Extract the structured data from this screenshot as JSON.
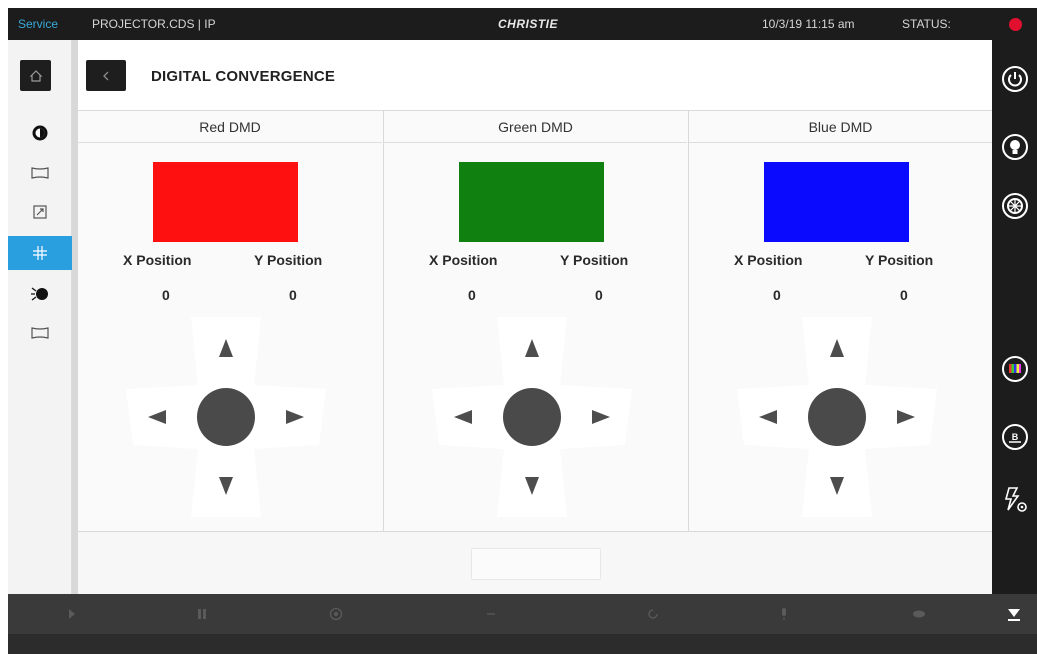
{
  "topbar": {
    "mode": "Service",
    "breadcrumb": "PROJECTOR.CDS | IP",
    "brand": "CHRISTIE",
    "datetime": "10/3/19  11:15 am",
    "status_label": "STATUS:",
    "status_color": "#e0102e"
  },
  "page": {
    "title": "DIGITAL CONVERGENCE"
  },
  "panels": [
    {
      "heading": "Red DMD",
      "swatch_color": "#ff1010",
      "x_label": "X Position",
      "y_label": "Y Position",
      "x_value": "0",
      "y_value": "0"
    },
    {
      "heading": "Green DMD",
      "swatch_color": "#108010",
      "x_label": "X Position",
      "y_label": "Y Position",
      "x_value": "0",
      "y_value": "0"
    },
    {
      "heading": "Blue DMD",
      "swatch_color": "#0a0aff",
      "x_label": "X Position",
      "y_label": "Y Position",
      "x_value": "0",
      "y_value": "0"
    }
  ],
  "leftnav": {
    "items": [
      "home-icon",
      "color-wheel-icon",
      "screen-icon",
      "resize-icon",
      "convergence-icon",
      "lamp-icon",
      "screen-icon"
    ],
    "active_index": 4,
    "accent": "#2a9fe0"
  },
  "rightnav": {
    "items": [
      "power-icon",
      "lightbulb-icon",
      "shutter-icon",
      "test-pattern-icon",
      "input-b-icon",
      "lightning-gear-icon"
    ]
  },
  "bottombar": {
    "icons": [
      "play-icon",
      "pause-icon",
      "record-icon",
      "minus-icon",
      "refresh-icon",
      "mic-icon",
      "eye-icon",
      "collapse-icon"
    ]
  }
}
